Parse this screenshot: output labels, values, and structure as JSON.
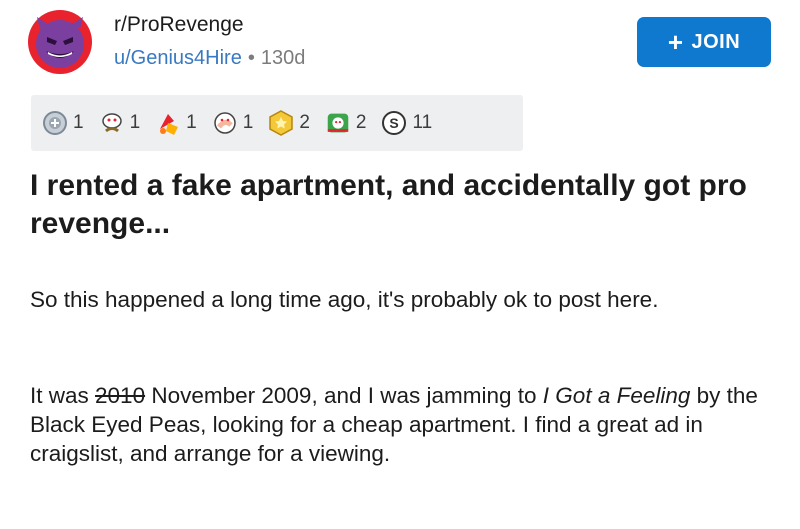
{
  "post": {
    "subreddit": "r/ProRevenge",
    "author": "u/Genius4Hire",
    "separator": "•",
    "age": "130d",
    "join_label": "JOIN",
    "join_icon": "plus-icon",
    "title": "I rented a fake apartment, and accidentally got pro revenge...",
    "awards": [
      {
        "icon": "silver-award-icon",
        "count": "1"
      },
      {
        "icon": "wholesome-award-icon",
        "count": "1"
      },
      {
        "icon": "rocket-like-award-icon",
        "count": "1"
      },
      {
        "icon": "facepalm-award-icon",
        "count": "1"
      },
      {
        "icon": "gold-award-icon",
        "count": "2"
      },
      {
        "icon": "helpful-award-icon",
        "count": "2"
      },
      {
        "icon": "bravo-award-icon",
        "count": "11"
      }
    ],
    "body": {
      "p1": "So this happened a long time ago, it's probably ok to post here.",
      "p2_a": "It was ",
      "p2_strike": "2010",
      "p2_b": " November 2009,  and I was jamming to ",
      "p2_italic": "I Got a Feeling",
      "p2_c": " by the Black Eyed Peas, looking for a cheap apartment.  I find a great ad in craigslist, and arrange for a viewing."
    }
  },
  "colors": {
    "join_button": "#0f79d0",
    "author_link": "#3979c2",
    "avatar_red": "#e8232e",
    "avatar_purple": "#7b3fa0",
    "award_bar": "#eeeff1"
  }
}
